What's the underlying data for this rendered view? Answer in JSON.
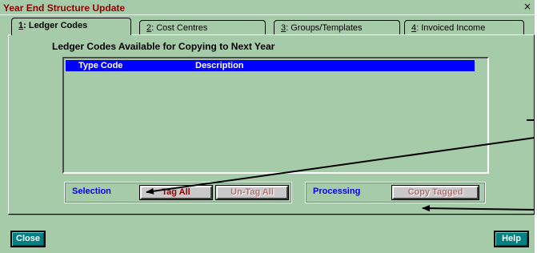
{
  "window": {
    "title": "Year End Structure Update",
    "close_glyph": "×"
  },
  "tabs": [
    {
      "hotkey": "1",
      "rest": ": Ledger Codes",
      "active": true
    },
    {
      "hotkey": "2",
      "rest": ": Cost Centres",
      "active": false
    },
    {
      "hotkey": "3",
      "rest": ": Groups/Templates",
      "active": false
    },
    {
      "hotkey": "4",
      "rest": ": Invoiced Income",
      "active": false
    }
  ],
  "main": {
    "section_title": "Ledger Codes Available for Copying to Next Year",
    "list": {
      "columns": [
        "Type Code",
        "Description"
      ],
      "rows": []
    }
  },
  "selection": {
    "label": "Selection",
    "tag_all": "Tag All",
    "untag_all": "Un-Tag All"
  },
  "processing": {
    "label": "Processing",
    "copy_tagged": "Copy Tagged"
  },
  "footer": {
    "close": "Close",
    "help": "Help"
  },
  "colors": {
    "window_bg": "#a6cba9",
    "title_text": "#8b0000",
    "list_header_bg": "#0000ff",
    "group_label": "#0000ff",
    "footer_button_bg": "#008080"
  },
  "annotation_arrows": {
    "count": 3
  }
}
